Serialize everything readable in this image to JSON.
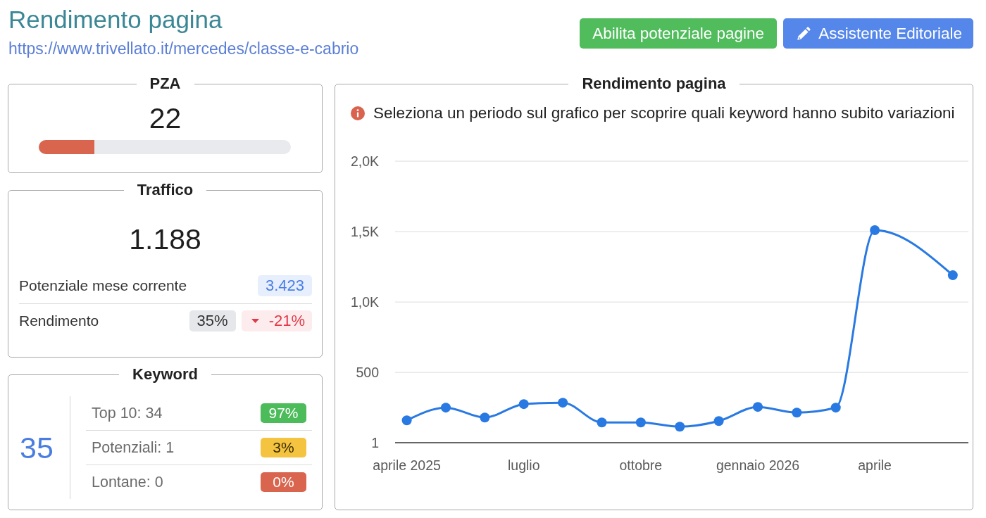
{
  "header": {
    "title": "Rendimento pagina",
    "url": "https://www.trivellato.it/mercedes/classe-e-cabrio"
  },
  "actions": [
    {
      "label": "Abilita potenziale pagine",
      "kind": "success"
    },
    {
      "label": "Assistente Editoriale",
      "kind": "primary"
    }
  ],
  "pza": {
    "title": "PZA",
    "score": "22",
    "level": 0.22
  },
  "traffic": {
    "title": "Traffico",
    "value": "1.188",
    "rows": [
      {
        "label": "Potenziale mese corrente",
        "badges": [
          {
            "text": "3.423",
            "kind": "info"
          }
        ]
      },
      {
        "label": "Rendimento",
        "badges": [
          {
            "text": "35%",
            "kind": "neutral"
          },
          {
            "text": "-21%",
            "kind": "decrease"
          }
        ]
      }
    ]
  },
  "keywords": {
    "title": "Keyword",
    "total": "35",
    "rows": [
      {
        "label": "Top 10: 34",
        "share": "97%",
        "color": "#4cbb5a"
      },
      {
        "label": "Potenziali: 1",
        "share": "3%",
        "color": "#f4c340"
      },
      {
        "label": "Lontane: 0",
        "share": "0%",
        "color": "#d9654f"
      }
    ]
  },
  "performance": {
    "title": "Rendimento pagina",
    "notice": "Seleziona un periodo sul grafico per scoprire quali keyword hanno subito variazioni",
    "chart_data": {
      "type": "line",
      "categories": [
        "aprile 2025",
        null,
        null,
        "luglio",
        null,
        null,
        "ottobre",
        null,
        null,
        "gennaio 2026",
        null,
        null,
        "aprile",
        null,
        null
      ],
      "series": [
        {
          "color": "#2979e3",
          "marker": "circle",
          "values": [
            160,
            250,
            180,
            275,
            285,
            145,
            145,
            115,
            155,
            255,
            215,
            250,
            1510,
            null,
            1190
          ]
        }
      ],
      "ylim": [
        1,
        2000
      ],
      "yticks": [
        {
          "value": 1,
          "label": "1"
        },
        {
          "value": 500,
          "label": "500"
        },
        {
          "value": 1000,
          "label": "1,0K"
        },
        {
          "value": 1500,
          "label": "1,5K"
        },
        {
          "value": 2000,
          "label": "2,0K"
        }
      ],
      "grid": true
    }
  }
}
